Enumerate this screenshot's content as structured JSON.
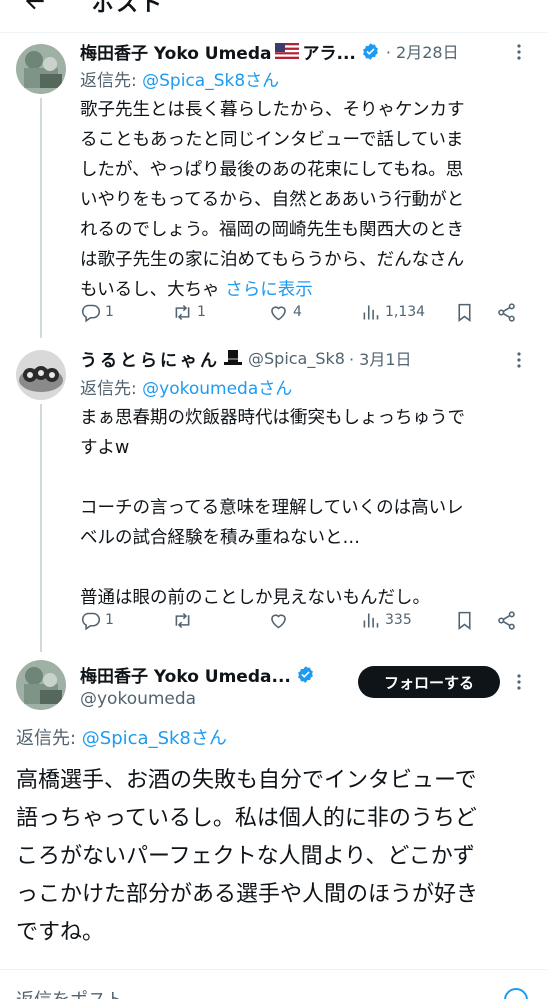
{
  "header": {
    "title": "ポスト"
  },
  "posts": [
    {
      "name": "梅田香子 Yoko Umeda",
      "name_suffix": "アラ...",
      "date": "· 2月28日",
      "reply_prefix": "返信先: ",
      "reply_handle": "@Spica_Sk8さん",
      "lines": [
        "歌子先生とは長く暮らしたから、そりゃケンカす",
        "ることもあったと同じインタビューで話していま",
        "したが、やっぱり最後のあの花束にしてもね。思",
        "いやりをもってるから、自然とああいう行動がと",
        "れるのでしょう。福岡の岡崎先生も関西大のとき",
        "は歌子先生の家に泊めてもらうから、だんなさん",
        "もいるし、大ちゃ "
      ],
      "show_more": "さらに表示",
      "stats": {
        "replies": "1",
        "reposts": "1",
        "likes": "4",
        "views": "1,134"
      }
    },
    {
      "name": "うるとらにゃん",
      "handle": "@Spica_Sk8",
      "date": "· 3月1日",
      "reply_prefix": "返信先: ",
      "reply_handle": "@yokoumedaさん",
      "lines": [
        "まぁ思春期の炊飯器時代は衝突もしょっちゅうで",
        "すよw",
        "",
        "コーチの言ってる意味を理解していくのは高いレ",
        "ベルの試合経験を積み重ねないと…",
        "",
        "普通は眼の前のことしか見えないもんだし。"
      ],
      "stats": {
        "replies": "1",
        "reposts": "",
        "likes": "",
        "views": "335"
      }
    }
  ],
  "main_post": {
    "name": "梅田香子 Yoko Umeda...",
    "handle": "@yokoumeda",
    "follow_label": "フォローする",
    "reply_prefix": "返信先: ",
    "reply_handle": "@Spica_Sk8さん",
    "lines": [
      "高橋選手、お酒の失敗も自分でインタビューで",
      "語っちゃっているし。私は個人的に非のうちど",
      "ころがないパーフェクトな人間より、どこかず",
      "っこかけた部分がある選手や人間のほうが好き",
      "ですね。"
    ]
  },
  "composer": {
    "placeholder": "返信をポスト"
  },
  "colors": {
    "accent": "#1d9bf0",
    "text": "#0f1419",
    "secondary": "#536471",
    "divider": "#eff3f4",
    "follow_bg": "#0f1419"
  },
  "icons": {
    "back": "arrow-left-icon",
    "verified": "verified-badge-icon",
    "more": "more-dots-icon",
    "reply": "reply-bubble-icon",
    "repost": "repost-icon",
    "like": "heart-icon",
    "views": "views-bars-icon",
    "bookmark": "bookmark-icon",
    "share": "share-icon",
    "flag": "us-flag-icon",
    "hat": "top-hat-icon"
  }
}
